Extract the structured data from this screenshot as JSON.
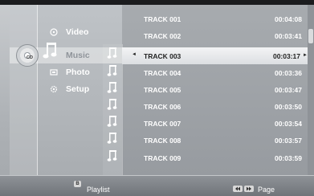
{
  "menu": {
    "items": [
      {
        "label": "Video",
        "icon": "video-icon"
      },
      {
        "label": "Music",
        "icon": "music-icon",
        "selected": true
      },
      {
        "label": "Photo",
        "icon": "photo-icon"
      },
      {
        "label": "Setup",
        "icon": "setup-icon"
      }
    ],
    "disc_label": "CD"
  },
  "tracks": [
    {
      "name": "TRACK 001",
      "time": "00:04:08"
    },
    {
      "name": "TRACK 002",
      "time": "00:03:41"
    },
    {
      "name": "TRACK 003",
      "time": "00:03:17",
      "selected": true
    },
    {
      "name": "TRACK 004",
      "time": "00:03:36"
    },
    {
      "name": "TRACK 005",
      "time": "00:03:47"
    },
    {
      "name": "TRACK 006",
      "time": "00:03:50"
    },
    {
      "name": "TRACK 007",
      "time": "00:03:54"
    },
    {
      "name": "TRACK 008",
      "time": "00:03:57"
    },
    {
      "name": "TRACK 009",
      "time": "00:03:59"
    }
  ],
  "bottom": {
    "b_key": "B",
    "playlist_label": "Playlist",
    "page_label": "Page"
  },
  "colors": {
    "selected_row": "#e8eaec",
    "text": "#ffffff",
    "background": "#a7abaf"
  }
}
